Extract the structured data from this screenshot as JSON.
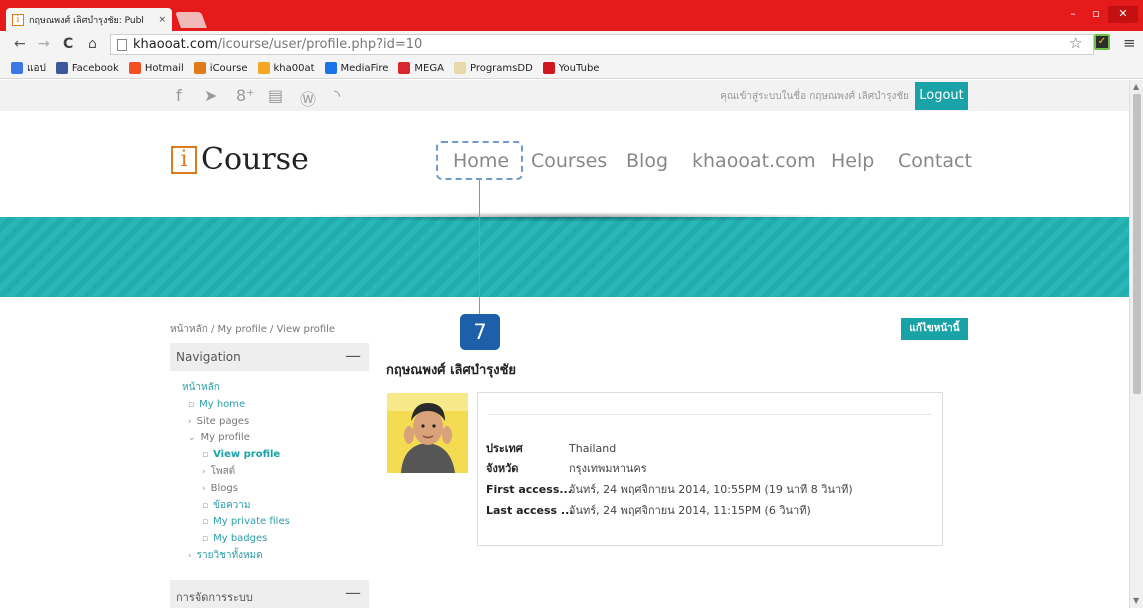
{
  "browser": {
    "tab_title": "กฤษณพงศ์ เลิศบำรุงชัย: Publ",
    "tab_close": "×",
    "url_host": "khaooat.com",
    "url_path": "/icourse/user/profile.php?id=10",
    "bookmarks": [
      {
        "label": "แอป",
        "color": "#3b78e7"
      },
      {
        "label": "Facebook",
        "color": "#3b5998"
      },
      {
        "label": "Hotmail",
        "color": "#f25022"
      },
      {
        "label": "iCourse",
        "color": "#e07b1a"
      },
      {
        "label": "kha00at",
        "color": "#f5a623"
      },
      {
        "label": "MediaFire",
        "color": "#1a73e8"
      },
      {
        "label": "MEGA",
        "color": "#d9272e"
      },
      {
        "label": "ProgramsDD",
        "color": "#e8d9a8"
      },
      {
        "label": "YouTube",
        "color": "#cc181e"
      }
    ]
  },
  "site": {
    "login_info": "คุณเข้าสู่ระบบในชื่อ กฤษณพงศ์ เลิศบำรุงชัย",
    "logout_label": "Logout",
    "logo_letter": "i",
    "logo_text": "Course",
    "nav": [
      "Home",
      "Courses",
      "Blog",
      "khaooat.com",
      "Help",
      "Contact"
    ],
    "annotation_number": "7",
    "breadcrumb": "หน้าหลัก / My profile / View profile",
    "edit_button": "แก้ไขหน้านี้",
    "navigation_title": "Navigation",
    "collapse_symbol": "—",
    "nav_tree": [
      {
        "label": "หน้าหลัก",
        "mark": "",
        "indent": 12,
        "style": "link"
      },
      {
        "label": "My home",
        "mark": "▫",
        "indent": 18,
        "style": "link"
      },
      {
        "label": "Site pages",
        "mark": "›",
        "indent": 18,
        "style": "gray"
      },
      {
        "label": "My profile",
        "mark": "⌄",
        "indent": 18,
        "style": "gray"
      },
      {
        "label": "View profile",
        "mark": "▫",
        "indent": 32,
        "style": "bold"
      },
      {
        "label": "โพสต์",
        "mark": "›",
        "indent": 32,
        "style": "gray"
      },
      {
        "label": "Blogs",
        "mark": "›",
        "indent": 32,
        "style": "gray"
      },
      {
        "label": "ข้อความ",
        "mark": "▫",
        "indent": 32,
        "style": "link"
      },
      {
        "label": "My private files",
        "mark": "▫",
        "indent": 32,
        "style": "link"
      },
      {
        "label": "My badges",
        "mark": "▫",
        "indent": 32,
        "style": "link"
      },
      {
        "label": "รายวิชาทั้งหมด",
        "mark": "›",
        "indent": 18,
        "style": "link"
      }
    ],
    "admin_title": "การจัดการระบบ"
  },
  "profile": {
    "name": "กฤษณพงศ์ เลิศบำรุงชัย",
    "fields": [
      {
        "label": "ประเทศ",
        "value": "Thailand"
      },
      {
        "label": "จังหวัด",
        "value": "กรุงเทพมหานคร"
      },
      {
        "label": "First access...",
        "value": "จันทร์, 24 พฤศจิกายน 2014, 10:55PM  (19 นาที 8 วินาที)"
      },
      {
        "label": "Last access ...",
        "value": "จันทร์, 24 พฤศจิกายน 2014, 11:15PM  (6 วินาที)"
      }
    ]
  }
}
